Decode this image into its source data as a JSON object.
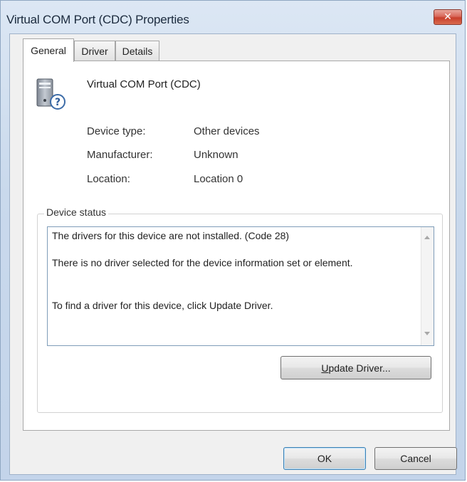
{
  "window": {
    "title": "Virtual COM Port (CDC) Properties",
    "close_glyph": "✕"
  },
  "tabs": [
    {
      "label": "General",
      "active": true
    },
    {
      "label": "Driver",
      "active": false
    },
    {
      "label": "Details",
      "active": false
    }
  ],
  "device": {
    "name": "Virtual COM Port (CDC)",
    "icon": "unknown-device-icon",
    "properties": [
      {
        "label": "Device type:",
        "value": "Other devices"
      },
      {
        "label": "Manufacturer:",
        "value": "Unknown"
      },
      {
        "label": "Location:",
        "value": "Location 0"
      }
    ]
  },
  "device_status": {
    "label": "Device status",
    "lines": [
      "The drivers for this device are not installed. (Code 28)",
      "There is no driver selected for the device information set or element.",
      "To find a driver for this device, click Update Driver."
    ]
  },
  "buttons": {
    "update_driver_prefix": "",
    "update_driver_mnemonic": "U",
    "update_driver_rest": "pdate Driver...",
    "ok": "OK",
    "cancel": "Cancel"
  },
  "colors": {
    "title_bar": "#c9d9ec",
    "close_button": "#c8402c",
    "panel_bg": "#ffffff"
  }
}
